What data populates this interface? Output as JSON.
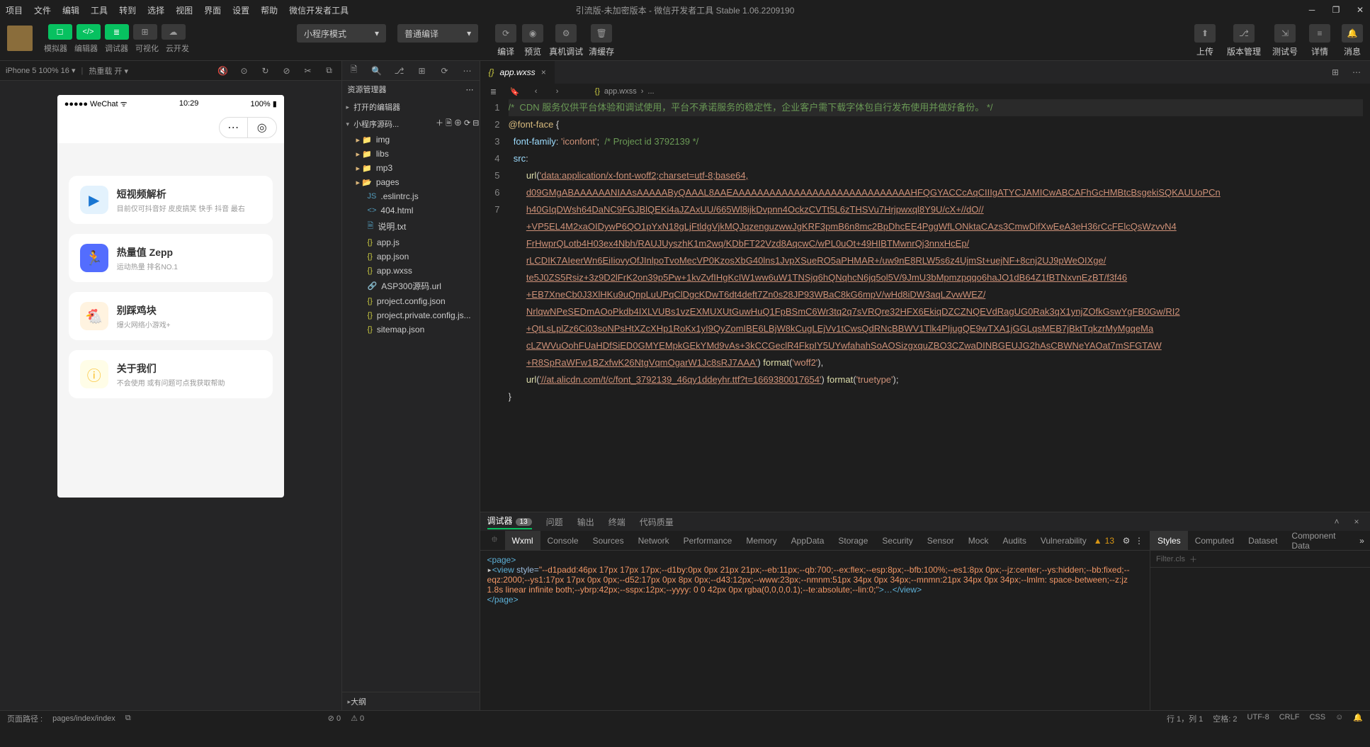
{
  "title": "引流版-未加密版本 - 微信开发者工具 Stable 1.06.2209190",
  "menus": [
    "项目",
    "文件",
    "编辑",
    "工具",
    "转到",
    "选择",
    "视图",
    "界面",
    "设置",
    "帮助",
    "微信开发者工具"
  ],
  "toolbar_mode_labels": [
    "模拟器",
    "编辑器",
    "调试器",
    "可视化",
    "云开发"
  ],
  "compile_dropdown1": "小程序模式",
  "compile_dropdown2": "普通编译",
  "center_tools": {
    "compile": "编译",
    "preview": "预览",
    "realdebug": "真机调试",
    "clearcache": "清缓存"
  },
  "right_tools": {
    "upload": "上传",
    "version": "版本管理",
    "testacct": "测试号",
    "detail": "详情",
    "msg": "消息"
  },
  "sim": {
    "device": "iPhone 5 100% 16",
    "hot": "热重载 开",
    "wechat": "WeChat",
    "time": "10:29",
    "battery": "100%"
  },
  "cards": [
    {
      "title": "短视频解析",
      "sub": "目前仅可抖音好 皮皮搞笑 快手 抖音 最右"
    },
    {
      "title": "热量值 Zepp",
      "sub": "运动热量 排名NO.1"
    },
    {
      "title": "别踩鸡块",
      "sub": "爆火网络小游戏+"
    },
    {
      "title": "关于我们",
      "sub": "不会使用 或有问题可点我获取帮助"
    }
  ],
  "explorer": {
    "title": "资源管理器",
    "section_open": "打开的编辑器",
    "section_proj": "小程序源码...",
    "files": [
      {
        "n": "img",
        "t": "folder",
        "i": 1
      },
      {
        "n": "libs",
        "t": "folder",
        "i": 1
      },
      {
        "n": "mp3",
        "t": "folder",
        "i": 1
      },
      {
        "n": "pages",
        "t": "folder-open",
        "i": 1
      },
      {
        "n": ".eslintrc.js",
        "t": "js",
        "i": 2
      },
      {
        "n": "404.html",
        "t": "html",
        "i": 2
      },
      {
        "n": "说明.txt",
        "t": "txt",
        "i": 2
      },
      {
        "n": "app.js",
        "t": "js-y",
        "i": 2
      },
      {
        "n": "app.json",
        "t": "json",
        "i": 2
      },
      {
        "n": "app.wxss",
        "t": "json",
        "i": 2
      },
      {
        "n": "ASP300源码.url",
        "t": "url",
        "i": 2
      },
      {
        "n": "project.config.json",
        "t": "json",
        "i": 2
      },
      {
        "n": "project.private.config.js...",
        "t": "json",
        "i": 2
      },
      {
        "n": "sitemap.json",
        "t": "json",
        "i": 2
      }
    ],
    "outline": "大纲"
  },
  "tab_name": "app.wxss",
  "breadcrumb": [
    "app.wxss",
    "..."
  ],
  "code": {
    "l1": "/*  CDN 服务仅供平台体验和调试使用，平台不承诺服务的稳定性，企业客户需下载字体包自行发布使用并做好备份。 */",
    "l2a": "@font-face",
    "l2b": " {",
    "l3a": "font-family",
    "l3b": ": ",
    "l3c": "'iconfont'",
    "l3d": ";  ",
    "l3e": "/* Project id 3792139 */",
    "l4a": "src",
    "l4b": ":",
    "l5a": "url",
    "l5b": "(",
    "l5c": "'data:application/x-font-woff2;charset=utf-8;base64,",
    "url_lines": [
      "d09GMgABAAAAAANIAAsAAAAAByQAAAL8AAEAAAAAAAAAAAAAAAAAAAAAAAAAAAAAHFQGYACCcAqCIIIgATYCJAMICwABCAFhGcHMBtcBsgekiSQKAUUoPCn",
      "h40GIqDWsh64DaNC9FGJBlQEKi4aJZAxUU/665Wl8ijkDvpnn4OckzCVTt5L6zTHSVu7Hrjpwxql8Y9U/cX+//dO//",
      "+VP5EL4M2xaOIDywP6QO1pYxN18gLjFtldgVjkMQJqzenguzwwJgKRF3pmB6n8mc2BpDhcEE4PggWfLONktaCAzs3CmwDifXwEeA3eH36rCcFElcQsWzvvN4",
      "FrHwprQLotb4H03ex4Nbh/RAUJUyszhK1m2wq/KDbFT22Vzd8AqcwC/wPL0uOt+49HIBTMwnrQj3nnxHcEp/",
      "rLCDIK7AIeerWn6EiIiovyOfJInlpoTvoMecVP0KzosXbG40lns1JvpXSueRO5aPHMAR+/uw9nE8RLW5s6z4UjmSt+uejNF+8cnj2UJ9pWeOIXge/",
      "te5J0ZS5Rsiz+3z9D2lFrK2on39p5Pw+1kvZvfIHgKcIW1ww6uW1TNSjq6hQNqhcN6jq5ol5V/9JmU3bMpmzpqqo6haJO1dB64Z1fBTNxvnEzBT/f3f46",
      "+EB7XneCb0J3XlHKu9uQnpLuUPqClDgcKDwT6dt4deft7Zn0s28JP93WBaC8kG6mpV/wHd8iDW3aqLZvwWEZ/",
      "NrlqwNPeSEDmAOoPkdb4IXLVUBs1vzEXMUXUtGuwHuQ1FpBSmC6Wr3tq2q7sVRQre32HFX6EkiqDZCZNQEVdRagUG0Rak3qX1ynjZOfkGswYgFB0Gw/RI2",
      "+QtLsLplZz6Ci03soNPsHtXZcXHp1RoKx1yI9QyZomIBE6LBjW8kCugLEjVv1tCwsQdRNcBBWV1Tlk4PIjugQE9wTXA1jGGLqsMEB7jBktTqkzrMyMgqeMa",
      "cLZWVuOohFUaHDfSiED0GMYEMpkGEkYMd9vAs+3kCCGeclR4FkpIY5UYwfahahSoAOSizgxquZBO3CZwaDINBGEUJG2hAsCBWNeYAOat7mSFGTAW",
      "+R8SpRaWFw1BZxfwK26NtgVqmOgarW1Jc8sRJ7AAA'"
    ],
    "l5end_a": ") ",
    "l5end_b": "format",
    "l5end_c": "(",
    "l5end_d": "'woff2'",
    "l5end_e": "),",
    "l6a": "url",
    "l6b": "(",
    "l6c": "'//at.alicdn.com/t/c/font_3792139_46qy1ddeyhr.ttf?t=1669380017654'",
    "l6d": ") ",
    "l6e": "format",
    "l6f": "(",
    "l6g": "'truetype'",
    "l6h": ");",
    "l7": "}"
  },
  "devtools": {
    "tabs1": [
      "调试器",
      "问题",
      "输出",
      "终端",
      "代码质量"
    ],
    "badge": "13",
    "tabs2": [
      "Wxml",
      "Console",
      "Sources",
      "Network",
      "Performance",
      "Memory",
      "AppData",
      "Storage",
      "Security",
      "Sensor",
      "Mock",
      "Audits",
      "Vulnerability"
    ],
    "warn_count": "13",
    "wxml": {
      "page_open": "<page>",
      "view_open": "<view ",
      "style_attr": "style=",
      "style_val": "\"--d1padd:46px 17px 17px 17px;--d1by:0px 0px 21px 21px;--eb:11px;--qb:700;--ex:flex;--esp:8px;--bfb:100%;--es1:8px 0px;--jz:center;--ys:hidden;--bb:fixed;--eqz:2000;--ys1:17px 17px 0px 0px;--d52:17px 0px 8px 0px;--d43:12px;--www:23px;--nmnm:51px 34px 0px 34px;--mnmn:21px 34px 0px 34px;--lmlm: space-between;--z:jz 1.8s linear infinite both;--ybrp:42px;--sspx:12px;--yyyy: 0 0 42px 0px rgba(0,0,0,0.1);--te:absolute;--lin:0;\"",
      "view_end": ">…</view>",
      "page_close": "</page>"
    },
    "right_tabs": [
      "Styles",
      "Computed",
      "Dataset",
      "Component Data"
    ],
    "filter": "Filter",
    "cls": ".cls"
  },
  "statusbar": {
    "path_label": "页面路径",
    "path": "pages/index/index",
    "err": "0",
    "warn": "0",
    "pos": "行 1，列 1",
    "spaces": "空格: 2",
    "enc": "UTF-8",
    "eol": "CRLF",
    "lang": "CSS"
  }
}
